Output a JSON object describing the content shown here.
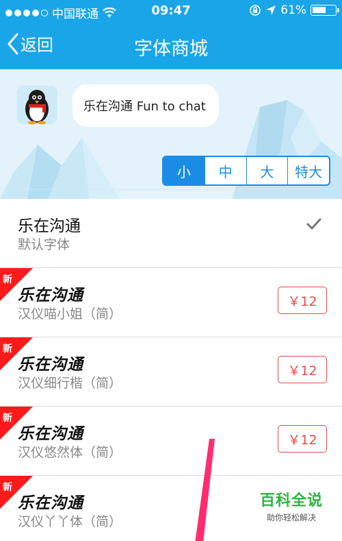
{
  "status_bar": {
    "carrier": "中国联通",
    "time": "09:47",
    "battery": "61%",
    "battery_level": 0.61
  },
  "nav": {
    "back_label": "返回",
    "title": "字体商城"
  },
  "banner": {
    "bubble_text": "乐在沟通 Fun to chat"
  },
  "size_tabs": {
    "items": [
      "小",
      "中",
      "大",
      "特大"
    ],
    "selected": "小"
  },
  "fonts": [
    {
      "sample": "乐在沟通",
      "name": "默认字体",
      "status": "selected"
    },
    {
      "sample": "乐在沟通",
      "name": "汉仪喵小姐（简）",
      "price": "￥12",
      "badge": "新"
    },
    {
      "sample": "乐在沟通",
      "name": "汉仪细行楷（简）",
      "price": "￥12",
      "badge": "新"
    },
    {
      "sample": "乐在沟通",
      "name": "汉仪悠然体（简）",
      "price": "￥12",
      "badge": "新"
    },
    {
      "sample": "乐在沟通",
      "name": "汉仪丫丫体（简）",
      "badge": "新"
    }
  ],
  "watermark": {
    "main": "百科全说",
    "sub": "助你轻松解决"
  },
  "colors": {
    "header": "#1aa5e8",
    "accent": "#1a8ce6",
    "price": "#f04848",
    "badge": "#ff1a1a",
    "watermark": "#2fb344"
  }
}
